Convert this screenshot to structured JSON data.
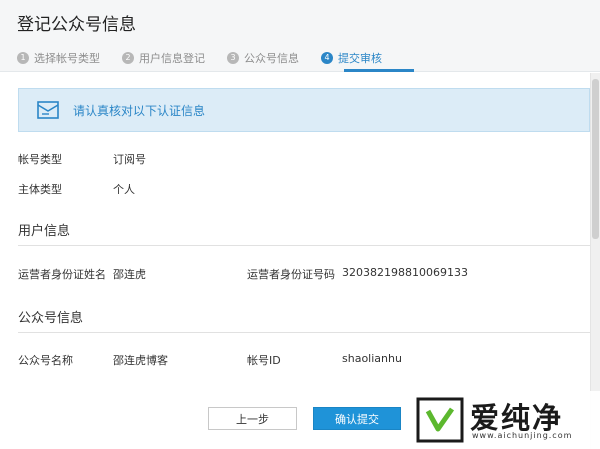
{
  "dialog": {
    "title": "登记公众号信息"
  },
  "steps": [
    {
      "num": "1",
      "label": "选择帐号类型"
    },
    {
      "num": "2",
      "label": "用户信息登记"
    },
    {
      "num": "3",
      "label": "公众号信息"
    },
    {
      "num": "4",
      "label": "提交审核"
    }
  ],
  "notice": {
    "text": "请认真核对以下认证信息"
  },
  "account": {
    "type_label": "帐号类型",
    "type_value": "订阅号",
    "subject_label": "主体类型",
    "subject_value": "个人"
  },
  "user_info": {
    "section_title": "用户信息",
    "name_label": "运营者身份证姓名",
    "name_value": "邵连虎",
    "id_label": "运营者身份证号码",
    "id_value": "320382198810069133"
  },
  "public_info": {
    "section_title": "公众号信息",
    "name_label": "公众号名称",
    "name_value": "邵连虎博客",
    "account_id_label": "帐号ID",
    "account_id_value": "shaolianhu"
  },
  "buttons": {
    "prev": "上一步",
    "submit": "确认提交"
  },
  "watermark": {
    "brand": "爱纯净",
    "url": "www.aichunjing.com"
  },
  "colors": {
    "accent": "#2b86c7",
    "notice_bg": "#dcecf7",
    "submit_bg": "#1f93d8"
  }
}
